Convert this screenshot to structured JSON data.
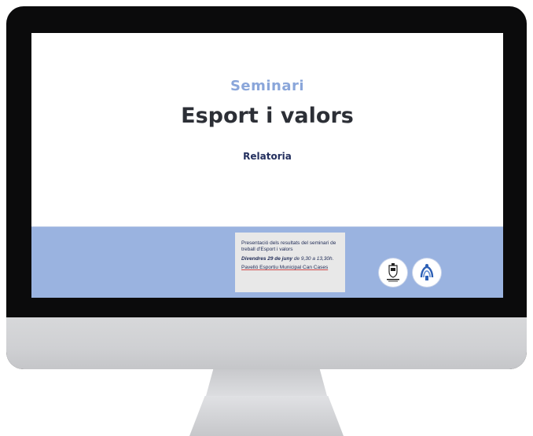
{
  "slide": {
    "kicker": "Seminari",
    "title": "Esport i valors",
    "subtitle": "Relatoria"
  },
  "info": {
    "description": "Presentació dels resultats del seminari de treball d'Esport i valors",
    "date_bold": "Divendres 29 de juny",
    "date_rest": " de 9,30 a 13,30h.",
    "place": "Pavelló Esportiu Municipal Can Cases"
  },
  "colors": {
    "band": "#9ab3e0",
    "kicker": "#8aa6da",
    "title": "#2c2f36",
    "subtitle": "#24305f",
    "bezel": "#0b0b0c",
    "chin": "#d2d3d6"
  },
  "logos": [
    "ajuntament-shield-icon",
    "sports-emblem-icon"
  ]
}
